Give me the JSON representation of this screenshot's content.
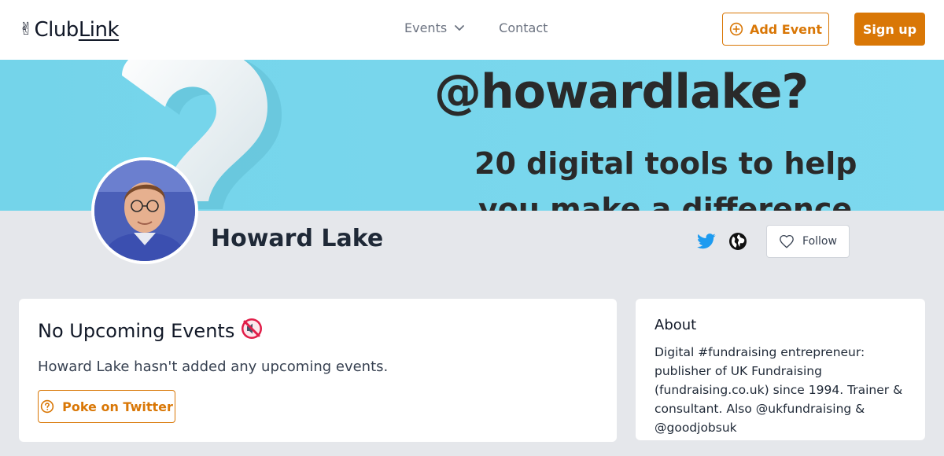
{
  "header": {
    "logo": {
      "peace_glyph": "✌",
      "club": "Club",
      "link": "Link"
    },
    "nav": {
      "events_label": "Events",
      "contact_label": "Contact"
    },
    "add_event_label": "Add Event",
    "signup_label": "Sign up"
  },
  "banner": {
    "line1": "@howardlake?",
    "line2": "20 digital tools to help",
    "line3": "you make a difference"
  },
  "profile": {
    "name": "Howard Lake",
    "follow_label": "Follow",
    "social_icons": [
      "twitter-icon",
      "globe-icon"
    ]
  },
  "events_card": {
    "title": "No Upcoming Events",
    "emoji": "🔇",
    "subtitle": "Howard Lake hasn't added any upcoming events.",
    "poke_label": "Poke on Twitter"
  },
  "about_card": {
    "title": "About",
    "text": "Digital #fundraising entrepreneur: publisher of UK Fundraising (fundraising.co.uk) since 1994. Trainer & consultant. Also @ukfundraising & @goodjobsuk"
  },
  "colors": {
    "accent": "#d97706",
    "twitter": "#1d9bf0",
    "banner": "#7dd9ef",
    "page_bg": "#e5e7eb"
  }
}
